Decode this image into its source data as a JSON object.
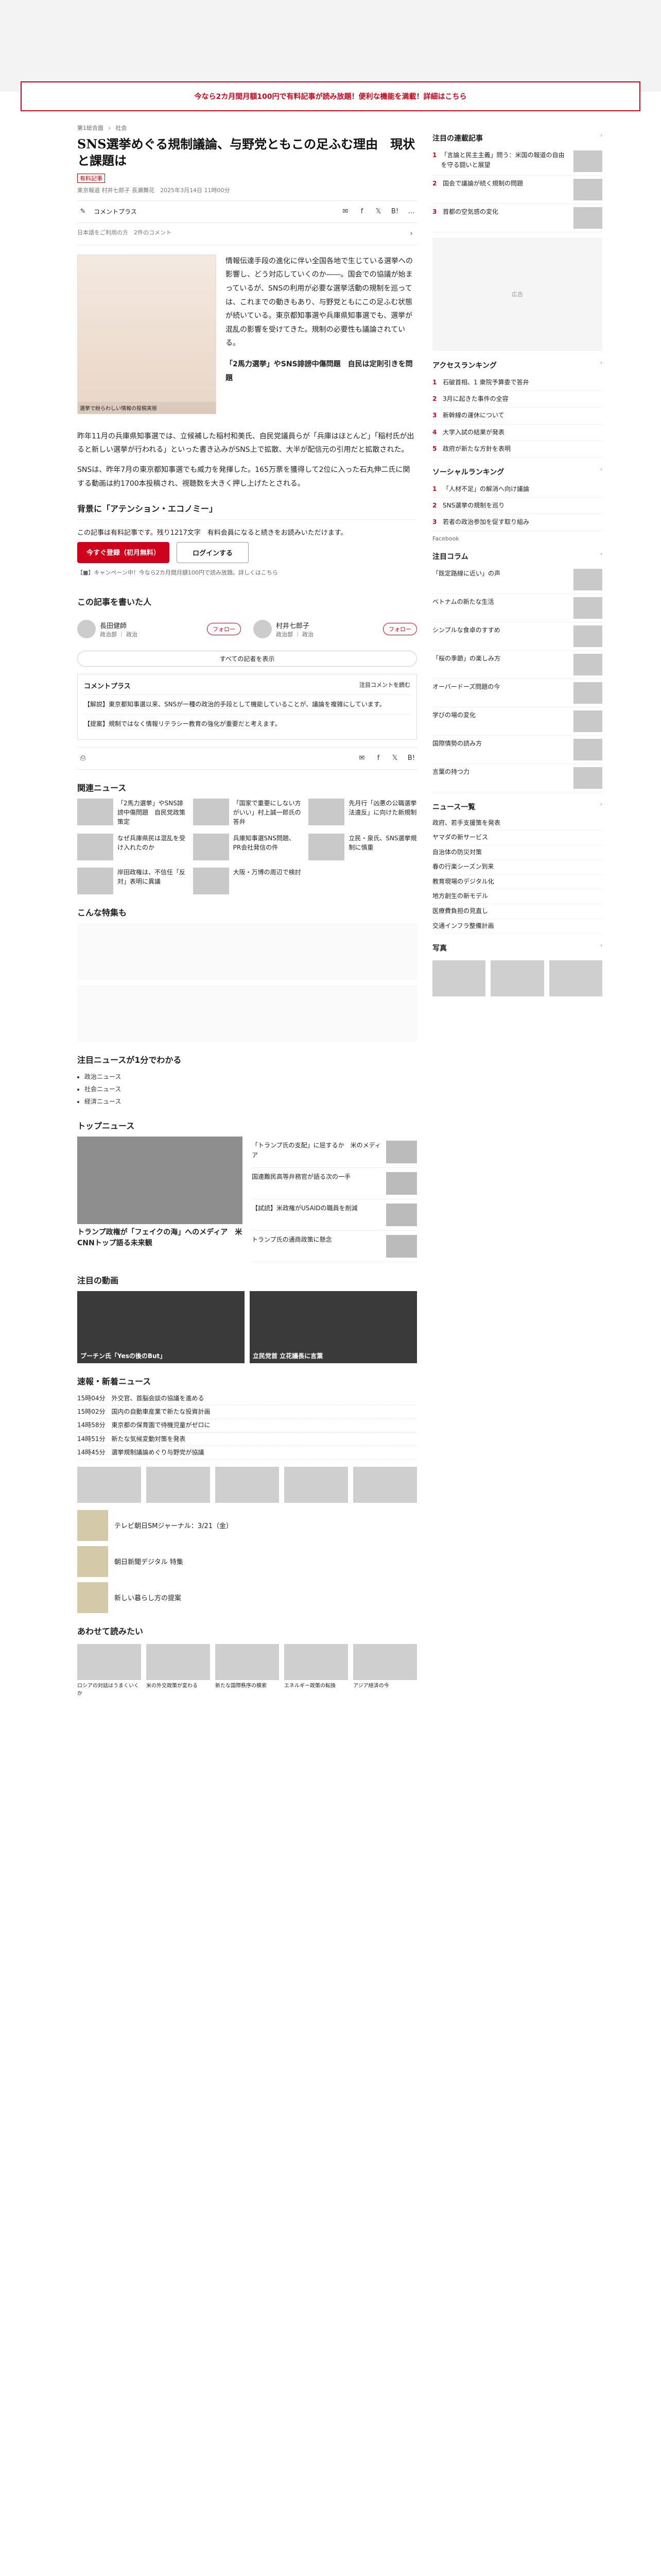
{
  "banner": "今なら2カ月間月額100円で有料記事が読み放題！便利な機能を満載！詳細はこちら",
  "crumbs": [
    "第1総合面",
    "社会"
  ],
  "tag": "有料記事",
  "title": "SNS選挙めぐる規制議論、与野党ともこの足ふむ理由　現状と課題は",
  "meta": "東京報道 村井七郎子 長瀬舞花　2025年3月14日 11時00分",
  "share": {
    "list": "リスト",
    "comment_count": "コメントプラス",
    "add": "Ⅱ",
    "b": "B!"
  },
  "comment_notice": "日本語をご利用の方　2件のコメント",
  "figure_caption": "選挙で紛らわしい情報の投稿実態",
  "lead": "情報伝達手段の進化に伴い全国各地で生じている選挙への影響し、どう対応していくのか――。国会での協議が始まっているが、SNSの利用が必要な選挙活動の規制を巡っては、これまでの動きもあり、与野党ともにこの足ふむ状態が続いている。東京都知事選や兵庫県知事選でも、選挙が混乱の影響を受けてきた。規制の必要性も議論されている。",
  "lead_bold": "「2馬力選挙」やSNS誹謗中傷問題　自民は定則引きを問題",
  "para1": "昨年11月の兵庫県知事選では、立候補した稲村和美氏、自民党議員らが「兵庫はほとんど」「稲村氏が出ると新しい選挙が行われる」といった書き込みがSNS上で拡散、大半が配信元の引用だと拡散された。",
  "para2": "SNSは、昨年7月の東京都知事選でも威力を発揮した。165万票を獲得して2位に入った石丸伸二氏に関する動画は約1700本投稿され、視聴数を大きく押し上げたとされる。",
  "section_heading": "背景に「アテンション・エコノミー」",
  "paywall": {
    "text": "この記事は有料記事です。残り1217文字　有料会員になると続きをお読みいただけます。",
    "subscribe": "今すぐ登録（初月無料）",
    "login": "ログインする",
    "note": "【■】キャンペーン中！今なら2カ月間月額100円で読み放題。詳しくはこちら"
  },
  "writers_title": "この記事を書いた人",
  "writers": [
    {
      "name": "長田健師",
      "role": "政治部 ｜ 政治",
      "follow": "フォロー"
    },
    {
      "name": "村井七郎子",
      "role": "政治部 ｜ 政治",
      "follow": "フォロー"
    }
  ],
  "writers_more": "すべての記者を表示",
  "comment_box": {
    "title": "コメントプラス",
    "link": "注目コメントを読む",
    "items": [
      "【解説】東京都知事選以来、SNSが一種の政治的手段として機能していることが、議論を複雑にしています。",
      "【提案】規制ではなく情報リテラシー教育の強化が重要だと考えます。"
    ]
  },
  "related_title": "関連ニュース",
  "related": [
    "「2馬力選挙」やSNS誹謗中傷問題　自民党政策策定",
    "「国家で重要にしない方がいい」村上誠一郎氏の答弁",
    "先月行「凶悪の公職選挙法違反」に向けた新規制",
    "なぜ兵庫県民は混乱を受け入れたのか",
    "兵庫知事選SNS問題、PR会社発信の件",
    "立民・泉氏、SNS選挙規制に慎重",
    "岸田政権は、不信任「反対」表明に異議",
    "大阪・万博の周辺で検討"
  ],
  "popular_title": "こんな特集も",
  "timeline_title": "注目ニュースが1分でわかる",
  "timeline_list": [
    "政治ニュース",
    "社会ニュース",
    "経済ニュース"
  ],
  "top_news_title": "トップニュース",
  "top_main_title": "トランプ政権が「フェイクの海」へのメディア　米CNNトップ語る未来観",
  "top_items": [
    "「トランプ氏の支配」に屈するか　米のメディア",
    "国連難民高等弁務官が語る次の一手",
    "【試読】米政権がUSAIDの職員を削減",
    "トランプ氏の通商政策に懸念"
  ],
  "video_title": "注目の動画",
  "video_labels": [
    "プーチン氏「Yesの後のBut」",
    "立民党首 立花議長に言葉"
  ],
  "quick_title": "速報・新着ニュース",
  "quick": [
    "15時04分　外交官、首脳会談の協議を進める",
    "15時02分　国内の自動車産業で新たな投資計画",
    "14時58分　東京都の保育園で待機児童がゼロに",
    "14時51分　新たな気候変動対策を発表",
    "14時45分　選挙規制議論めぐり与野党が協議"
  ],
  "more_photos_title": "あわせて読みたい",
  "photos": [
    "ロシアの対話はうまくいくか",
    "米の外交政策が変わる",
    "新たな国際秩序の模索",
    "エネルギー政策の転換",
    "アジア経済の今"
  ],
  "brand_items": [
    "テレビ朝日SMジャーナル：3/21（金）",
    "朝日新聞デジタル 特集",
    "新しい暮らし方の提案"
  ],
  "side": {
    "ranking1_title": "注目の連載記事",
    "ranking1": [
      "「言論と民主主義」問う：米国の報道の自由を守る闘いと展望",
      "国会で議論が続く規制の問題",
      "首都の空気感の変化"
    ],
    "ad_label": "広告",
    "ranking2_title": "アクセスランキング",
    "ranking2": [
      "石破首相、1 衆院予算委で答弁",
      "3月に起きた事件の全容",
      "新幹線の運休について",
      "大学入試の結果が発表",
      "政府が新たな方針を表明"
    ],
    "ranking3_title": "ソーシャルランキング",
    "ranking3": [
      "「人材不足」の解消へ向け議論",
      "SNS選挙の規制を巡り",
      "若者の政治参加を促す取り組み"
    ],
    "columns_title": "注目コラム",
    "columns": [
      "「既定路線に近い」の声",
      "ベトナムの新たな生活",
      "シンプルな食卓のすすめ",
      "「桜の季節」の楽しみ方",
      "オーバードーズ問題の今",
      "学びの場の変化",
      "国際情勢の読み方",
      "言葉の持つ力"
    ],
    "list_title": "ニュース一覧",
    "list": [
      "政府、若手支援策を発表",
      "ヤマダの新サービス",
      "自治体の防災対策",
      "春の行楽シーズン到来",
      "教育現場のデジタル化",
      "地方創生の新モデル",
      "医療費負担の見直し",
      "交通インフラ整備計画"
    ],
    "photo_title": "写真",
    "facebook": "Facebook"
  }
}
